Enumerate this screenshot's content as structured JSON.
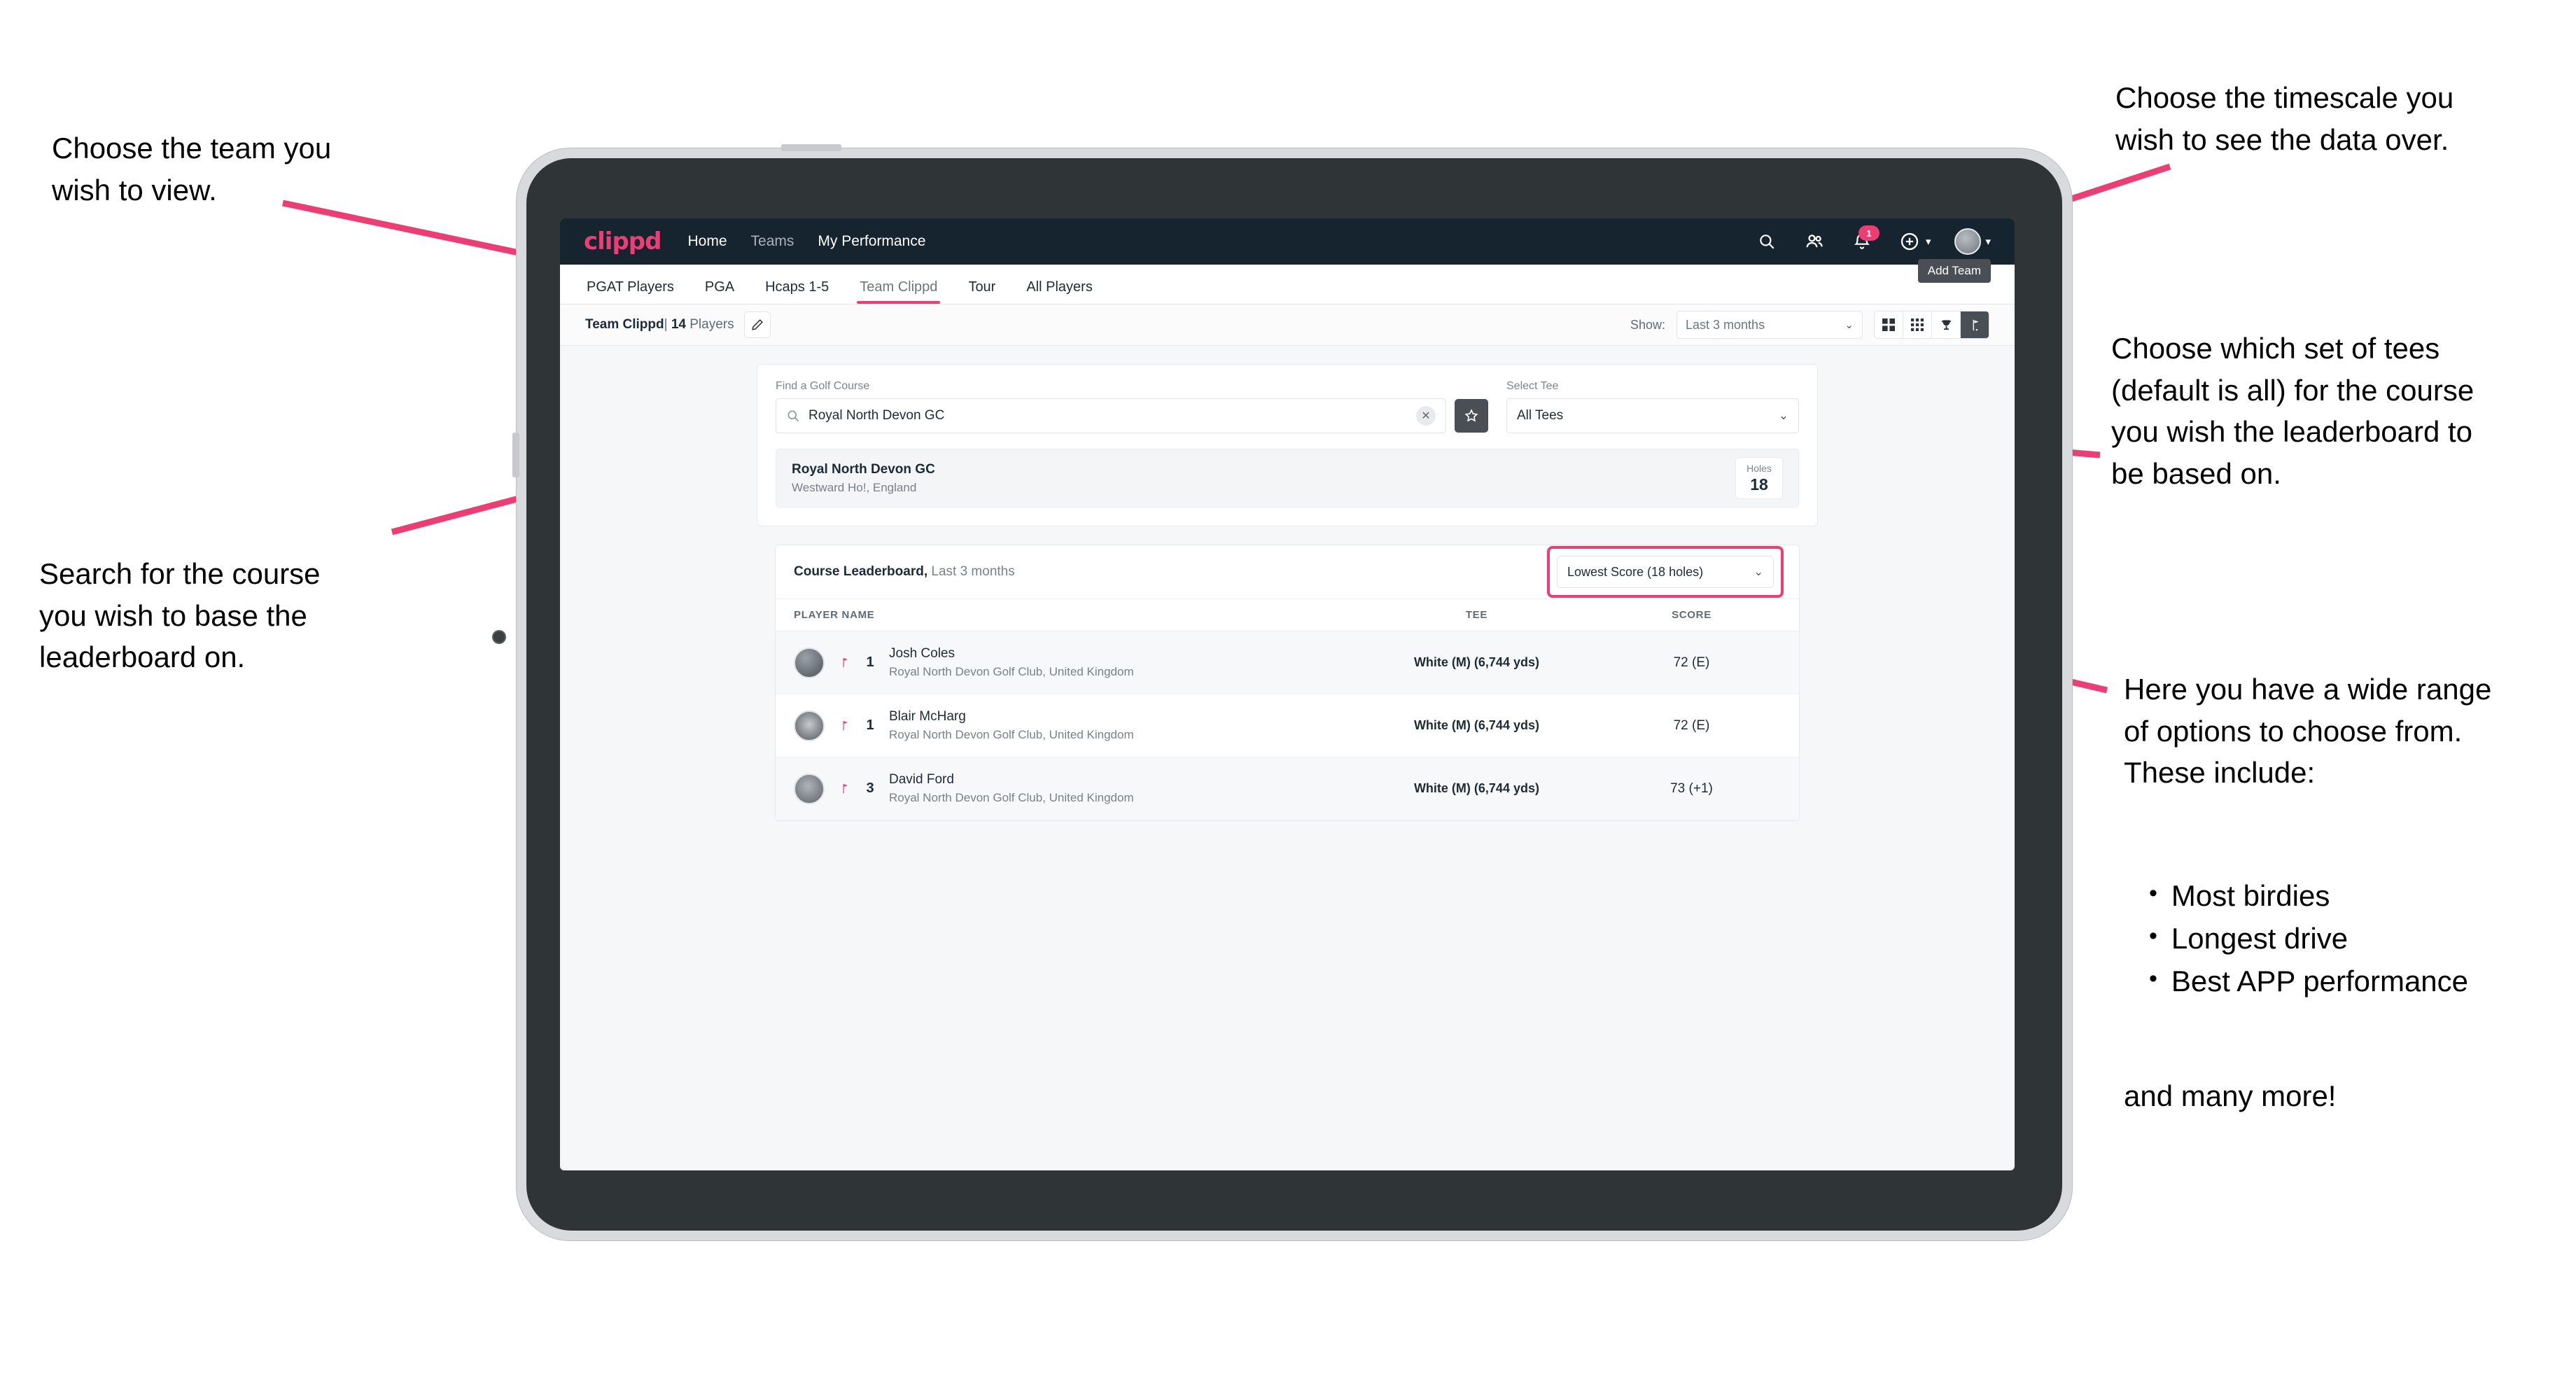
{
  "annotations": {
    "team": "Choose the team you\nwish to view.",
    "timescale": "Choose the timescale you\nwish to see the data over.",
    "tees": "Choose which set of tees\n(default is all) for the course\nyou wish the leaderboard to\nbe based on.",
    "search": "Search for the course\nyou wish to base the\nleaderboard on.",
    "options_intro": "Here you have a wide range\nof options to choose from.\nThese include:",
    "options_list": [
      "Most birdies",
      "Longest drive",
      "Best APP performance"
    ],
    "options_outro": "and many more!"
  },
  "app": {
    "logo": "clippd",
    "nav": [
      {
        "label": "Home",
        "active": true
      },
      {
        "label": "Teams",
        "active": false
      },
      {
        "label": "My Performance",
        "active": true
      }
    ],
    "icons": {
      "search": "search-icon",
      "people": "people-icon",
      "bell": "bell-icon",
      "bell_badge": "1",
      "plus": "plus-icon",
      "avatar": "user-avatar"
    },
    "tooltip": "Add Team",
    "tabs": [
      {
        "label": "PGAT Players",
        "state": "normal"
      },
      {
        "label": "PGA",
        "state": "normal"
      },
      {
        "label": "Hcaps 1-5",
        "state": "normal"
      },
      {
        "label": "Team Clippd",
        "state": "active"
      },
      {
        "label": "Tour",
        "state": "normal"
      },
      {
        "label": "All Players",
        "state": "normal"
      }
    ],
    "toolbar": {
      "team_name": "Team Clippd",
      "separator": "|",
      "player_count": "14",
      "players_word": "Players",
      "edit_icon": "pencil-icon",
      "show_label": "Show:",
      "timescale_value": "Last 3 months",
      "views": [
        "grid-large-icon",
        "grid-small-icon",
        "trophy-icon",
        "golf-flag-icon"
      ],
      "active_view": "golf-flag-icon"
    },
    "search_panel": {
      "course_label": "Find a Golf Course",
      "course_value": "Royal North Devon GC",
      "course_placeholder": "Find a Golf Course",
      "clear_icon": "close-icon",
      "favourite_icon": "star-icon",
      "tee_label": "Select Tee",
      "tee_value": "All Tees"
    },
    "course_result": {
      "name": "Royal North Devon GC",
      "location": "Westward Ho!, England",
      "holes_label": "Holes",
      "holes_value": "18"
    },
    "leaderboard": {
      "title": "Course Leaderboard,",
      "subtitle": "Last 3 months",
      "metric": "Lowest Score (18 holes)",
      "columns": [
        "PLAYER NAME",
        "TEE",
        "SCORE"
      ],
      "rows": [
        {
          "rank": "1",
          "name": "Josh Coles",
          "club": "Royal North Devon Golf Club, United Kingdom",
          "tee": "White (M) (6,744 yds)",
          "score": "72 (E)"
        },
        {
          "rank": "1",
          "name": "Blair McHarg",
          "club": "Royal North Devon Golf Club, United Kingdom",
          "tee": "White (M) (6,744 yds)",
          "score": "72 (E)"
        },
        {
          "rank": "3",
          "name": "David Ford",
          "club": "Royal North Devon Golf Club, United Kingdom",
          "tee": "White (M) (6,744 yds)",
          "score": "73 (+1)"
        }
      ]
    }
  },
  "colors": {
    "accent": "#ee3d72",
    "nav_bg": "#16242f",
    "dark_btn": "#4a4f55"
  }
}
